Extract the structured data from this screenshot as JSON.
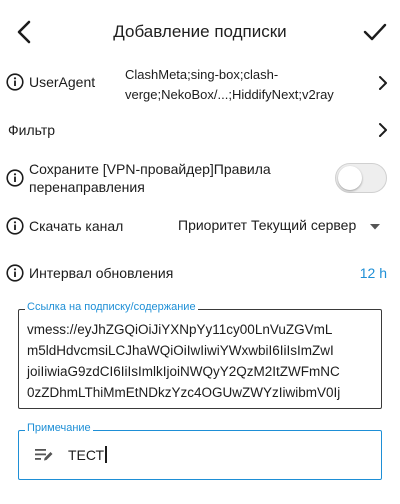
{
  "header": {
    "title": "Добавление подписки",
    "back_icon": "arrow-back-icon",
    "confirm_icon": "check-icon"
  },
  "user_agent": {
    "label": "UserAgent",
    "value_line1": "ClashMeta;sing-box;clash-",
    "value_line2": "verge;NekoBox/...;HiddifyNext;v2ray"
  },
  "filter": {
    "label": "Фильтр"
  },
  "redirect_rules": {
    "label_line1": "Сохраните [VPN-провайдер]Правила",
    "label_line2": "перенаправления",
    "enabled": false
  },
  "download_channel": {
    "label": "Скачать канал",
    "value": "Приоритет Текущий сервер"
  },
  "update_interval": {
    "label": "Интервал обновления",
    "value": "12 h"
  },
  "subscription_link": {
    "label": "Ссылка на подписку/содержание",
    "line1": "vmess://eyJhZGQiOiJiYXNpYy11cy00LnVuZGVmL",
    "line2": "m5ldHdvcmsiLCJhaWQiOiIwIiwiYWxwbiI6IiIsImZwI",
    "line3": "joiIiwiaG9zdCI6IiIsImlkIjoiNWQyY2QzM2ItZWFmNC",
    "line4": "0zZDhmLThiMmEtNDkzYzc4OGUwZWYzIiwibmV0Ij"
  },
  "note": {
    "label": "Примечание",
    "value": "ТЕСТ"
  },
  "colors": {
    "accent": "#1e8fd6",
    "text": "#1c1c1c",
    "background": "#ffffff"
  }
}
